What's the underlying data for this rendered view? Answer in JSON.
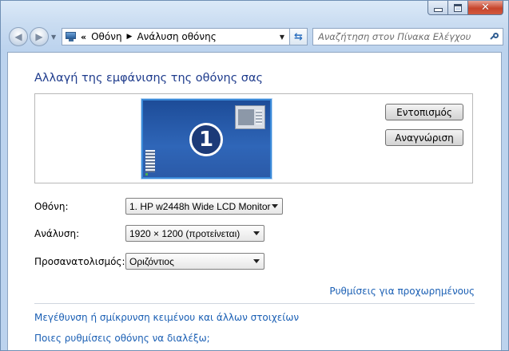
{
  "nav": {
    "breadcrumb_chevron": "«",
    "breadcrumb": [
      "Οθόνη",
      "Ανάλυση οθόνης"
    ],
    "search_placeholder": "Αναζήτηση στον Πίνακα Ελέγχου"
  },
  "main": {
    "title": "Αλλαγή της εμφάνισης της οθόνης σας",
    "monitor_number": "1",
    "detect_label": "Εντοπισμός",
    "identify_label": "Αναγνώριση",
    "display_label": "Οθόνη:",
    "display_value": "1. HP w2448h Wide LCD Monitor",
    "resolution_label": "Ανάλυση:",
    "resolution_value": "1920 × 1200 (προτείνεται)",
    "orientation_label": "Προσανατολισμός:",
    "orientation_value": "Οριζόντιος",
    "advanced_link": "Ρυθμίσεις για προχωρημένους",
    "text_size_link": "Μεγέθυνση ή σμίκρυνση κειμένου και άλλων στοιχείων",
    "which_settings_link": "Ποιες ρυθμίσεις οθόνης να διαλέξω;"
  },
  "colors": {
    "title": "#1e3b8c",
    "link": "#1a5fb4",
    "monitor": "#2f66b8"
  }
}
